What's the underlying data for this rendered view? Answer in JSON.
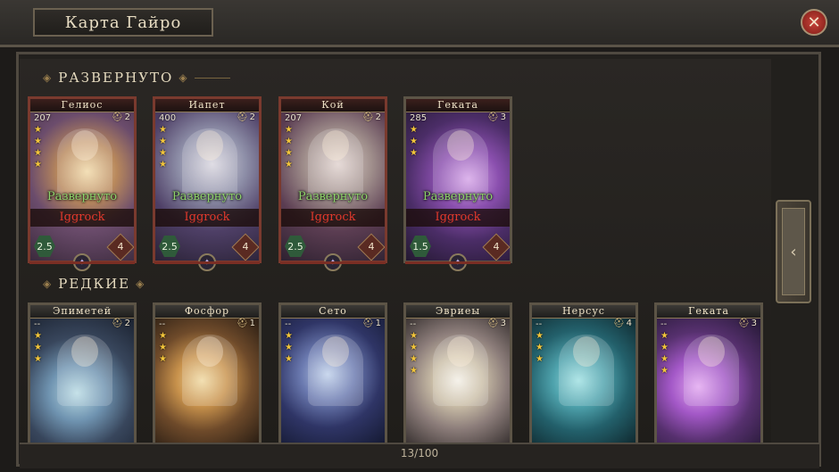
{
  "header": {
    "title": "Карта Гайро",
    "close_icon": "close-icon"
  },
  "sections": {
    "deployed_title": "РАЗВЕРНУТО",
    "rare_title": "РЕДКИЕ"
  },
  "deployed_cards": [
    {
      "name": "Гелиос",
      "power": "207",
      "level": "2",
      "stars": 4,
      "status": "Развернуто",
      "owner": "Iggrock",
      "cost": "2.5",
      "attack": "4"
    },
    {
      "name": "Иапет",
      "power": "400",
      "level": "2",
      "stars": 4,
      "status": "Развернуто",
      "owner": "Iggrock",
      "cost": "2.5",
      "attack": "4"
    },
    {
      "name": "Кой",
      "power": "207",
      "level": "2",
      "stars": 4,
      "status": "Развернуто",
      "owner": "Iggrock",
      "cost": "2.5",
      "attack": "4"
    },
    {
      "name": "Геката",
      "power": "285",
      "level": "3",
      "stars": 3,
      "status": "Развернуто",
      "owner": "Iggrock",
      "cost": "1.5",
      "attack": "4"
    }
  ],
  "rare_cards": [
    {
      "name": "Эпиметей",
      "power": "--",
      "level": "2",
      "stars": 3
    },
    {
      "name": "Фосфор",
      "power": "--",
      "level": "1",
      "stars": 3
    },
    {
      "name": "Сето",
      "power": "--",
      "level": "1",
      "stars": 3
    },
    {
      "name": "Эвриеы",
      "power": "--",
      "level": "3",
      "stars": 4
    },
    {
      "name": "Нерсус",
      "power": "--",
      "level": "4",
      "stars": 3
    },
    {
      "name": "Геката",
      "power": "--",
      "level": "3",
      "stars": 4
    }
  ],
  "side_tab": {
    "arrow": "‹"
  },
  "pagination": {
    "counter": "13/100"
  },
  "colors": {
    "status": "#8ed36a",
    "owner": "#e2392c",
    "star": "#f2c53a"
  }
}
